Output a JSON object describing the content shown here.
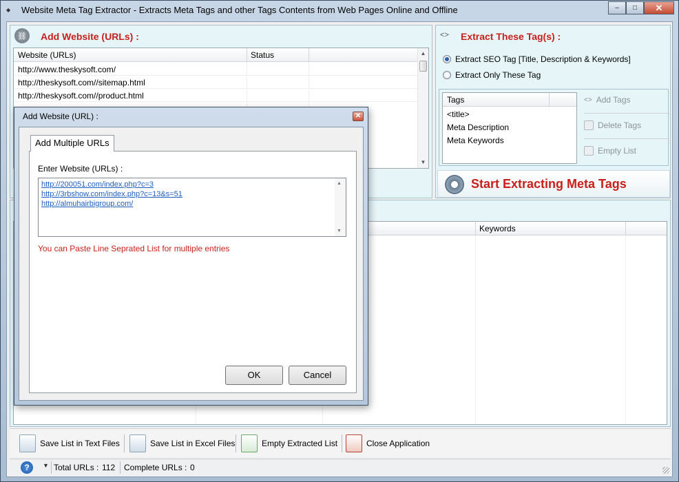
{
  "window": {
    "title": "Website Meta Tag Extractor - Extracts Meta Tags and other Tags Contents from Web Pages Online and Offline",
    "minimize": "–",
    "maximize": "□",
    "close": "✕"
  },
  "add_website": {
    "header": "Add Website (URLs) :",
    "columns": [
      "Website (URLs)",
      "Status"
    ],
    "rows": [
      {
        "url": "http://www.theskysoft.com/",
        "status": ""
      },
      {
        "url": "http://theskysoft.com//sitemap.html",
        "status": ""
      },
      {
        "url": "http://theskysoft.com//product.html",
        "status": ""
      }
    ]
  },
  "extract_tags": {
    "header": "Extract These Tag(s) :",
    "options": [
      {
        "label": "Extract SEO Tag [Title, Description & Keywords]",
        "selected": true
      },
      {
        "label": "Extract Only These Tag",
        "selected": false
      }
    ],
    "tags_header": "Tags",
    "tags": [
      "<title>",
      "Meta Description",
      "Meta Keywords"
    ],
    "actions": {
      "add": "Add Tags",
      "delete": "Delete Tags",
      "empty": "Empty List"
    },
    "start_label": "Start Extracting Meta Tags"
  },
  "results": {
    "columns": [
      "Keywords"
    ]
  },
  "toolbar": {
    "save_text": "Save List in Text Files",
    "save_excel": "Save List in Excel Files",
    "empty_list": "Empty Extracted List",
    "close_app": "Close Application"
  },
  "status": {
    "help": "?",
    "total_label": "Total URLs :",
    "total_value": "112",
    "complete_label": "Complete URLs :",
    "complete_value": "0"
  },
  "dialog": {
    "title": "Add Website (URL) :",
    "tab": "Add Multiple URLs",
    "input_label": "Enter Website (URLs) :",
    "urls": [
      "http://200051.com/index.php?c=3",
      "http://3rbshow.com/index.php?c=13&s=51",
      "http://almuhairbigroup.com/"
    ],
    "hint": "You can Paste Line Seprated List for multiple entries",
    "ok": "OK",
    "cancel": "Cancel"
  }
}
